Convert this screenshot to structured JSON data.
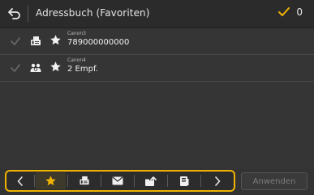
{
  "header": {
    "title": "Adressbuch (Favoriten)",
    "selected_count": "0"
  },
  "entries": [
    {
      "name": "Canon3",
      "detail": "789000000000",
      "type_icon": "fax-icon"
    },
    {
      "name": "Canon4",
      "detail": "2 Empf.",
      "type_icon": "group-icon"
    }
  ],
  "filter_bar": {
    "buttons": [
      "previous",
      "favorites",
      "fax",
      "email",
      "shared-folder",
      "file-server",
      "next"
    ],
    "active": "favorites"
  },
  "apply_label": "Anwenden",
  "colors": {
    "accent": "#f0b400",
    "background": "#333333"
  }
}
